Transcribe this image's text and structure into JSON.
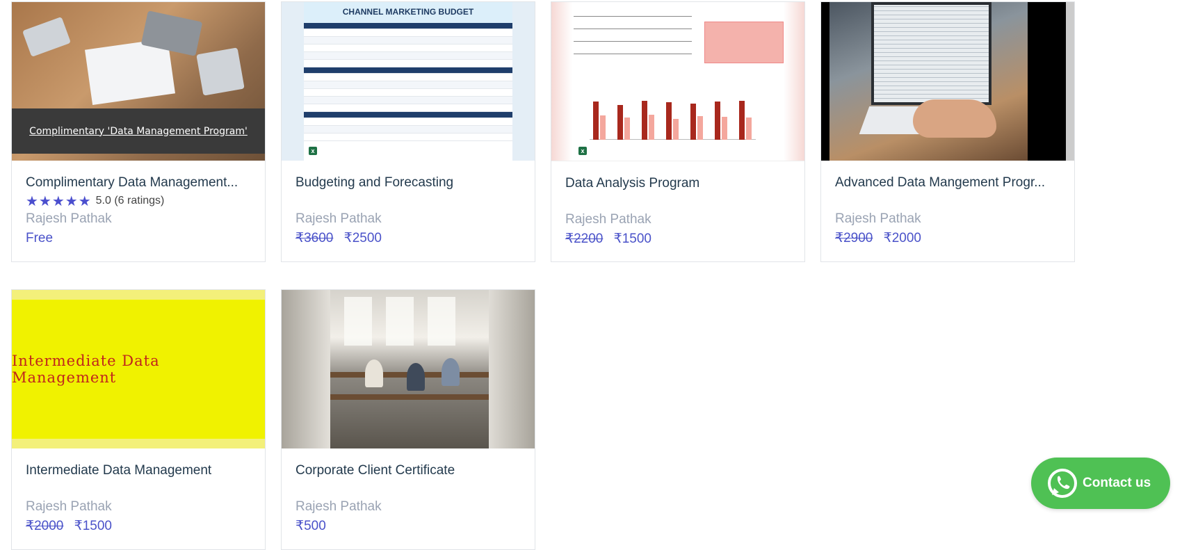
{
  "courses": [
    {
      "title": "Complimentary Data Management...",
      "thumbnail_text": "Complimentary 'Data Management Program'",
      "rating_stars": 5,
      "rating_text": "5.0 (6 ratings)",
      "author": "Rajesh Pathak",
      "price": "Free"
    },
    {
      "title": "Budgeting and Forecasting",
      "thumbnail_text": "CHANNEL MARKETING BUDGET",
      "author": "Rajesh Pathak",
      "old_price": "₹3600",
      "price": "₹2500"
    },
    {
      "title": "Data Analysis Program",
      "author": "Rajesh Pathak",
      "old_price": "₹2200",
      "price": "₹1500"
    },
    {
      "title": "Advanced Data Mangement Progr...",
      "author": "Rajesh Pathak",
      "old_price": "₹2900",
      "price": "₹2000"
    },
    {
      "title": "Intermediate Data Management",
      "thumbnail_text": "Intermediate Data Management",
      "author": "Rajesh Pathak",
      "old_price": "₹2000",
      "price": "₹1500"
    },
    {
      "title": "Corporate Client Certificate",
      "author": "Rajesh Pathak",
      "price": "₹500"
    }
  ],
  "contact": {
    "label": "Contact us",
    "icon": "whatsapp-icon"
  },
  "colors": {
    "accent": "#4a52c9",
    "title": "#233a4d",
    "author": "#9aa3b3",
    "whatsapp": "#4fc154"
  }
}
